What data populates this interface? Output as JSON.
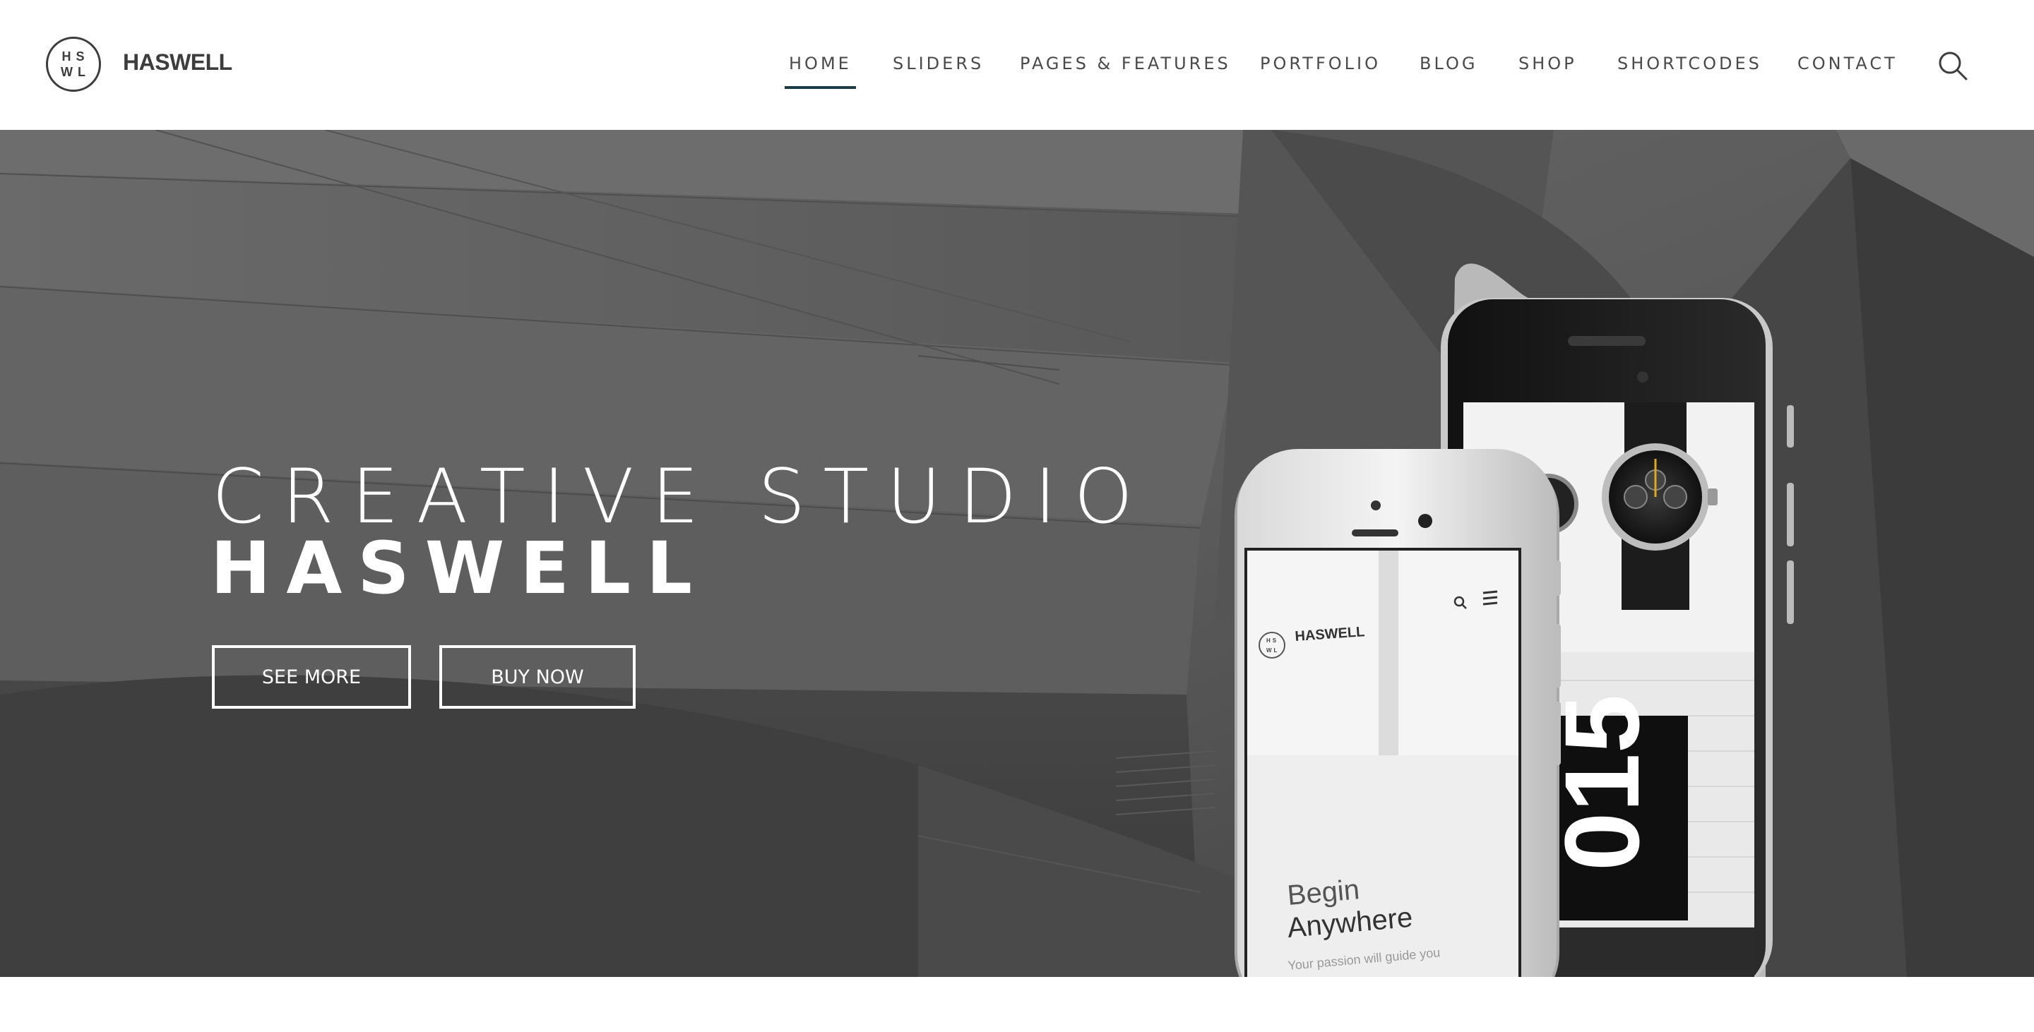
{
  "brand": {
    "logo_top": "HS",
    "logo_bottom": "WL",
    "name": "HASWELL"
  },
  "nav": {
    "items": [
      {
        "label": "HOME",
        "active": true
      },
      {
        "label": "SLIDERS",
        "active": false
      },
      {
        "label": "PAGES & FEATURES",
        "active": false
      },
      {
        "label": "PORTFOLIO",
        "active": false
      },
      {
        "label": "BLOG",
        "active": false
      },
      {
        "label": "SHOP",
        "active": false
      },
      {
        "label": "SHORTCODES",
        "active": false
      },
      {
        "label": "CONTACT",
        "active": false
      }
    ],
    "search_icon": "search-icon"
  },
  "hero": {
    "title_line1": "CREATIVE STUDIO",
    "title_line2": "HASWELL",
    "buttons": {
      "see_more": "SEE MORE",
      "buy_now": "BUY NOW"
    },
    "phone_mockup": {
      "brand_name": "HASWELL",
      "logo_top": "HS",
      "logo_bottom": "WL",
      "headline_1": "Begin",
      "headline_2": "Anywhere",
      "tagline": "Your passion will guide you",
      "poster_text": "015"
    }
  },
  "colors": {
    "nav_active_underline": "#1f3b46",
    "nav_text": "#4a4a4a",
    "hero_text": "#ffffff",
    "hero_background": "#5b5b5b"
  }
}
